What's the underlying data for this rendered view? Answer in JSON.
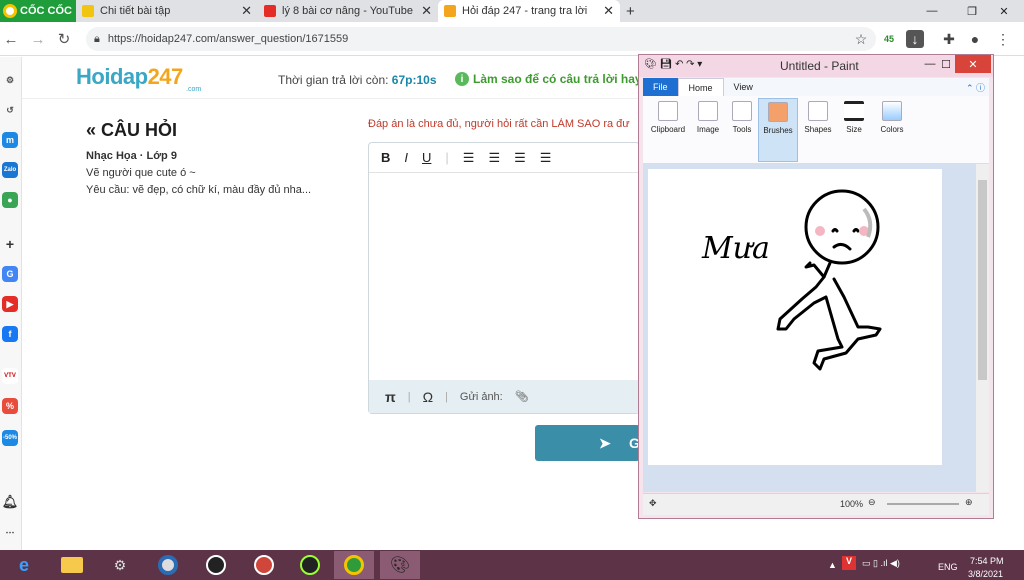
{
  "browser": {
    "brand": "CỐC CỐC",
    "tabs": [
      {
        "title": "Chi tiết bài tập",
        "color": "#f1c40f"
      },
      {
        "title": "lý 8 bài cơ nâng - YouTube",
        "color": "#e52d27"
      },
      {
        "title": "Hỏi đáp 247 - trang tra lời",
        "color": "#f3a61d"
      }
    ],
    "new_tab": "+",
    "url": "https://hoidap247.com/answer_question/1671559",
    "extension_badge": "45"
  },
  "page": {
    "logo_main": "Hoidap",
    "logo_num": "247",
    "logo_suffix": ".com",
    "timer_label": "Thời gian trả lời còn:",
    "timer_value": "67p:10s",
    "hint": "Làm sao để có câu trả lời hay!",
    "question_heading": "« CÂU HỎI",
    "subject": "Nhạc Họa · Lớp 9",
    "question_lines": [
      "Vẽ người que cute ó ~",
      "Yêu cầu: vẽ đẹp, có chữ kí, màu đầy đủ nha..."
    ],
    "warning": "Đáp án là chưa đủ, người hỏi rất cần LÀM SAO ra đư",
    "editor_tools": [
      "B",
      "I",
      "U"
    ],
    "footer_pi": "π",
    "footer_omega": "Ω",
    "footer_upload": "Gửi ảnh:",
    "send_label": "G"
  },
  "paint": {
    "title": "Untitled - Paint",
    "tabs": [
      "File",
      "Home",
      "View"
    ],
    "groups": [
      "Clipboard",
      "Image",
      "Tools",
      "Brushes",
      "Shapes",
      "Size",
      "Colors"
    ],
    "signature_text": "Mưa",
    "zoom": "100%"
  },
  "taskbar": {
    "lang": "ENG",
    "time": "7:54 PM",
    "date": "3/8/2021"
  },
  "colors": {
    "accent": "#3a8ea8",
    "taskbar": "#5c3347",
    "paint_frame": "#f3d7e4"
  }
}
